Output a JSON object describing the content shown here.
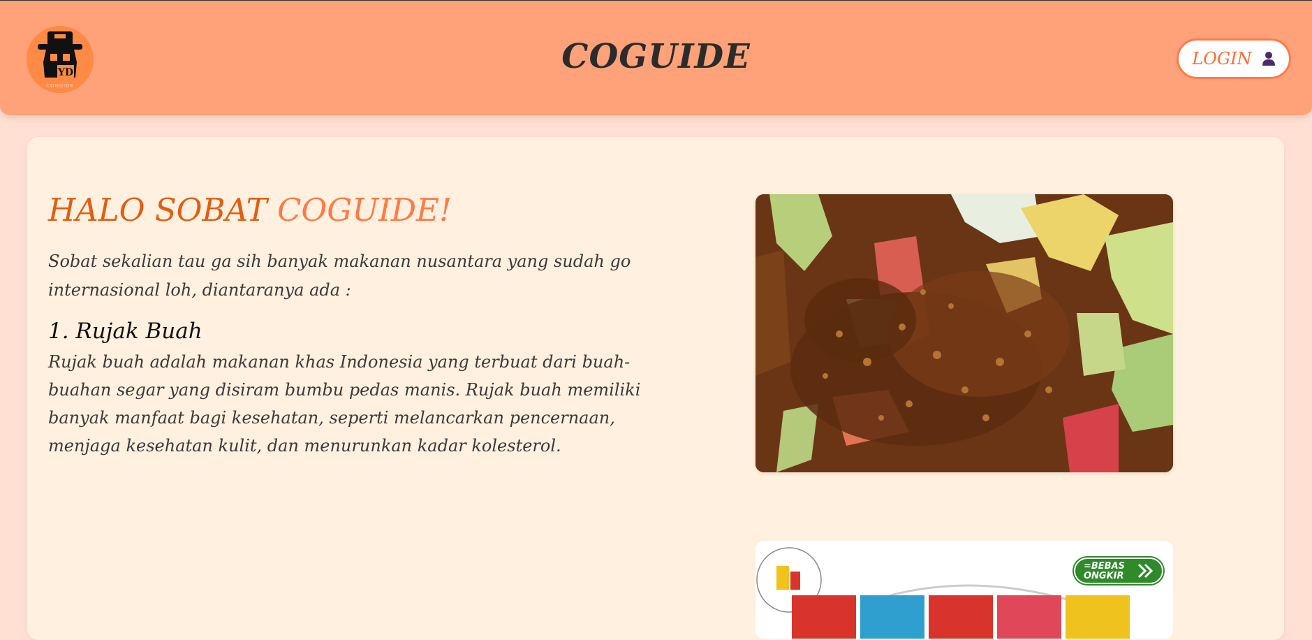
{
  "header": {
    "logo_text": "COGUIDE",
    "logo_initials": "YD",
    "title": "COGUIDE",
    "login_label": "LOGIN"
  },
  "main": {
    "greeting_part1": "HALO SOBAT",
    "greeting_part2": "COGUIDE!",
    "intro": "Sobat sekalian tau ga sih banyak makanan nusantara yang sudah go internasional loh, diantaranya ada :",
    "item_title": "1. Rujak Buah",
    "item_description": "Rujak buah adalah makanan khas Indonesia yang terbuat dari buah-buahan segar yang disiram bumbu pedas manis. Rujak buah memiliki banyak manfaat bagi kesehatan, seperti melancarkan pencernaan, menjaga kesehatan kulit, dan menurunkan kadar kolesterol.",
    "banner": {
      "badge_text": "=BEBAS ONGKIR"
    }
  },
  "colors": {
    "header_bg": "#ffa27a",
    "page_bg": "#ffe0d2",
    "card_bg": "#fff0df",
    "accent_dark": "#e05e12",
    "accent_light": "#ff7a45",
    "login_border": "#ff7a4a",
    "badge_green": "#2f8a2a"
  },
  "icons": {
    "logo": "coguide-logo-icon",
    "login": "user-icon",
    "badge": "double-chevron-right-icon"
  }
}
